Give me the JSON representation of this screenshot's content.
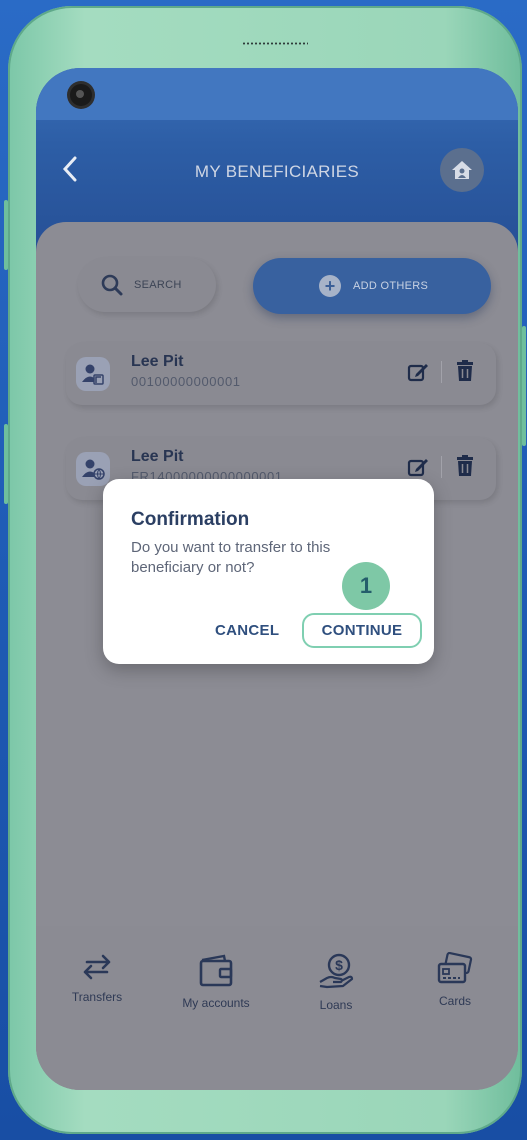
{
  "header": {
    "title": "MY BENEFICIARIES",
    "back_icon": "chevron-left-icon",
    "home_icon": "home-icon"
  },
  "actions": {
    "search_label": "SEARCH",
    "add_label": "ADD OTHERS"
  },
  "beneficiaries": [
    {
      "name": "Lee Pit",
      "account": "00100000000001",
      "type_icon": "user-bank-icon"
    },
    {
      "name": "Lee Pit",
      "account": "FR14000000000000001",
      "type_icon": "user-globe-icon"
    }
  ],
  "dialog": {
    "title": "Confirmation",
    "message": "Do you want to transfer to this beneficiary or not?",
    "cancel_label": "CANCEL",
    "continue_label": "CONTINUE"
  },
  "step_badge": "1",
  "bottom_nav": [
    {
      "label": "Transfers",
      "icon": "transfer-arrows-icon"
    },
    {
      "label": "My accounts",
      "icon": "wallet-icon"
    },
    {
      "label": "Loans",
      "icon": "money-hand-icon"
    },
    {
      "label": "Cards",
      "icon": "cards-icon"
    }
  ],
  "colors": {
    "header_blue": "#2d5ea6",
    "accent_blue": "#38619f",
    "highlight_green": "#7ec8a6",
    "frame_green": "#9ad6b9"
  }
}
